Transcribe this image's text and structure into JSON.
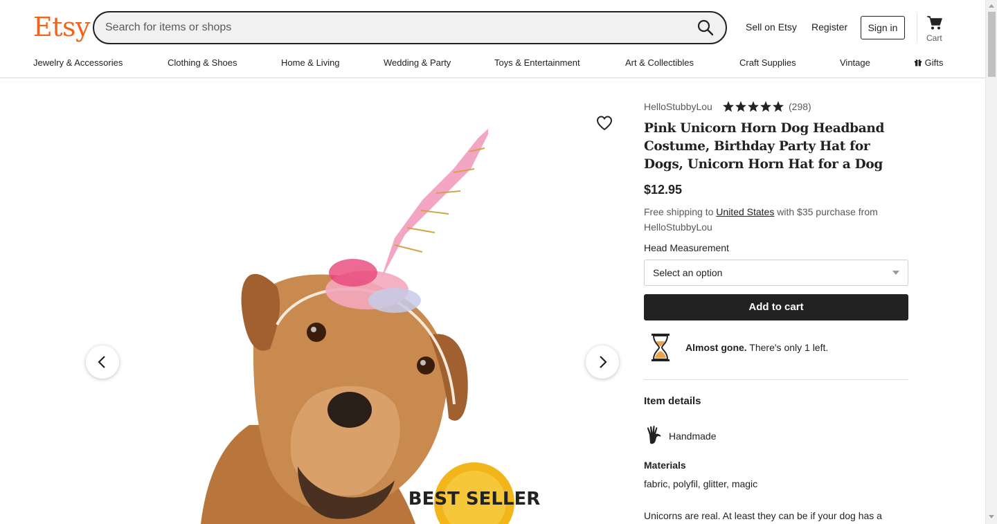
{
  "header": {
    "logo": "Etsy",
    "search_placeholder": "Search for items or shops",
    "sell_link": "Sell on Etsy",
    "register_link": "Register",
    "signin_button": "Sign in",
    "cart_label": "Cart"
  },
  "nav": {
    "items": [
      "Jewelry & Accessories",
      "Clothing & Shoes",
      "Home & Living",
      "Wedding & Party",
      "Toys & Entertainment",
      "Art & Collectibles",
      "Craft Supplies",
      "Vintage",
      "Gifts"
    ]
  },
  "listing": {
    "badge_text": "BEST SELLER",
    "shop_name": "HelloStubbyLou",
    "rating_stars": 5,
    "review_count": "(298)",
    "title": "Pink Unicorn Horn Dog Headband Costume, Birthday Party Hat for Dogs, Unicorn Horn Hat for a Dog",
    "price": "$12.95",
    "shipping_prefix": "Free shipping to ",
    "shipping_country": "United States",
    "shipping_suffix": " with $35 purchase from HelloStubbyLou",
    "variation_label": "Head Measurement",
    "variation_value": "Select an option",
    "add_to_cart": "Add to cart",
    "stock_bold": "Almost gone.",
    "stock_text": " There's only 1 left.",
    "details_heading": "Item details",
    "handmade": "Handmade",
    "materials_heading": "Materials",
    "materials": "fabric, polyfil, glitter, magic",
    "description": "Unicorns are real. At least they can be if your dog has a"
  },
  "colors": {
    "brand": "#f1641e",
    "button_dark": "#222222",
    "text_muted": "#595959"
  }
}
